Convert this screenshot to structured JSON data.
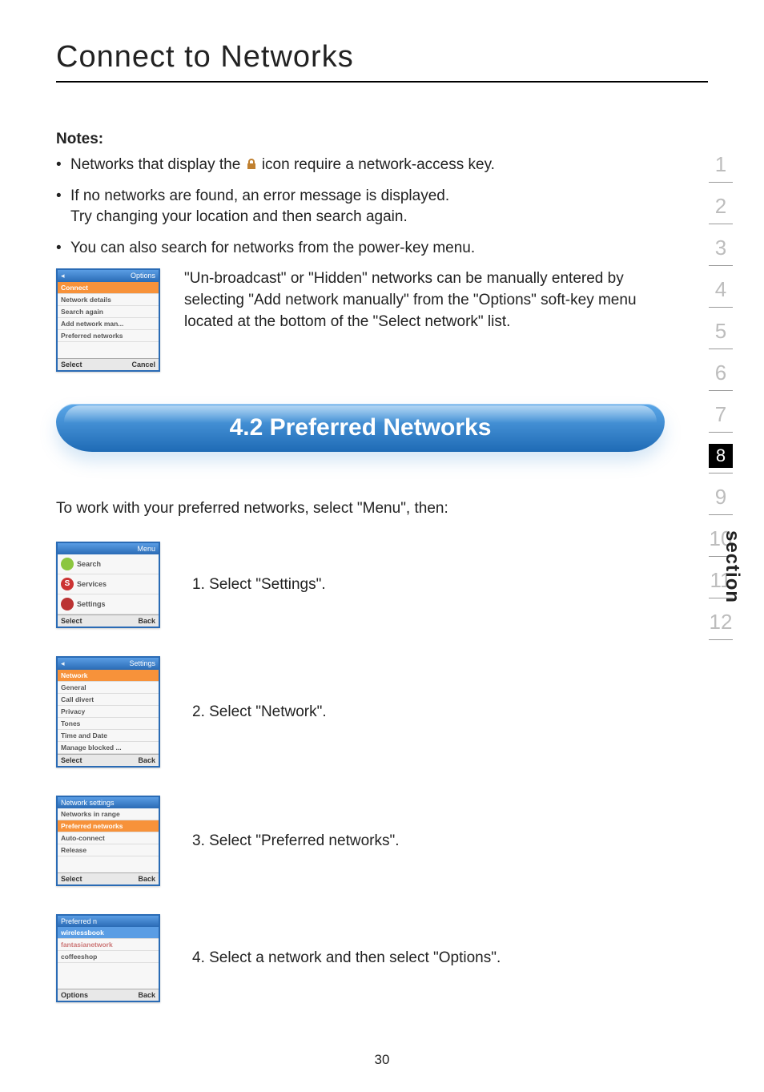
{
  "title": "Connect to Networks",
  "notes_heading": "Notes:",
  "bullets": {
    "b1a": "Networks that display the",
    "b1b": "icon require a network-access key.",
    "b2a": "If no networks are found, an error message is displayed.",
    "b2b": "Try changing your location and then search again.",
    "b3": "You can also search for networks from the power-key menu."
  },
  "hidden_para": "\"Un-broadcast\" or \"Hidden\" networks can be manually entered by selecting \"Add network manually\" from the \"Options\" soft-key menu located at the bottom of the \"Select network\" list.",
  "banner": "4.2 Preferred Networks",
  "intro": "To work with your preferred networks, select \"Menu\", then:",
  "steps": {
    "s1": "1. Select \"Settings\".",
    "s2": "2. Select \"Network\".",
    "s3": "3. Select \"Preferred networks\".",
    "s4": "4. Select a network and then select \"Options\"."
  },
  "thumbs": {
    "t1": {
      "header_r": "Options",
      "lines": [
        "Connect",
        "Network details",
        "Search again",
        "Add network man...",
        "Preferred networks"
      ],
      "foot_l": "Select",
      "foot_r": "Cancel"
    },
    "t2": {
      "header_r": "Menu",
      "lines": [
        "Search",
        "Services",
        "Settings"
      ],
      "foot_l": "Select",
      "foot_r": "Back"
    },
    "t3": {
      "header_r": "Settings",
      "lines": [
        "Network",
        "General",
        "Call divert",
        "Privacy",
        "Tones",
        "Time and Date",
        "Manage blocked ..."
      ],
      "foot_l": "Select",
      "foot_r": "Back"
    },
    "t4": {
      "header": "Network settings",
      "lines": [
        "Networks in range",
        "Preferred networks",
        "Auto-connect",
        "Release"
      ],
      "foot_l": "Select",
      "foot_r": "Back"
    },
    "t5": {
      "header": "Preferred n",
      "lines": [
        "wirelessbook",
        "fantasianetwork",
        "coffeeshop"
      ],
      "foot_l": "Options",
      "foot_r": "Back"
    }
  },
  "sections": [
    "1",
    "2",
    "3",
    "4",
    "5",
    "6",
    "7",
    "8",
    "9",
    "10",
    "11",
    "12"
  ],
  "active_section": "8",
  "section_label": "section",
  "page_number": "30"
}
